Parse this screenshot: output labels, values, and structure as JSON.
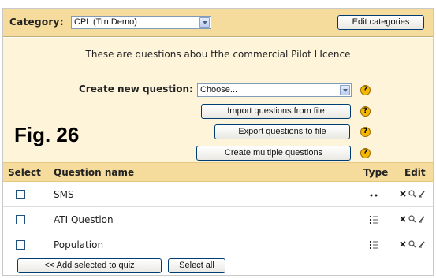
{
  "header": {
    "category_label": "Category:",
    "category_value": "CPL (Trn Demo)",
    "edit_categories_label": "Edit categories"
  },
  "panel": {
    "description": "These are questions abou tthe commercial Pilot LIcence",
    "create_label": "Create new question:",
    "create_select_value": "Choose...",
    "import_label": "Import questions from file",
    "export_label": "Export questions to file",
    "multiple_label": "Create multiple questions",
    "help_glyph": "?",
    "figure_caption": "Fig. 26"
  },
  "table": {
    "headers": {
      "select": "Select",
      "name": "Question name",
      "type": "Type",
      "edit": "Edit"
    },
    "rows": [
      {
        "name": "SMS",
        "type_icon": "short-answer-icon"
      },
      {
        "name": "ATI Question",
        "type_icon": "multichoice-icon"
      },
      {
        "name": "Population",
        "type_icon": "multichoice-icon"
      }
    ]
  },
  "footer": {
    "add_selected_label": "<< Add selected to quiz",
    "select_all_label": "Select all"
  },
  "colors": {
    "header_bg": "#f6dc9c",
    "panel_bg": "#fef4da",
    "help_icon": "#f5b800"
  }
}
